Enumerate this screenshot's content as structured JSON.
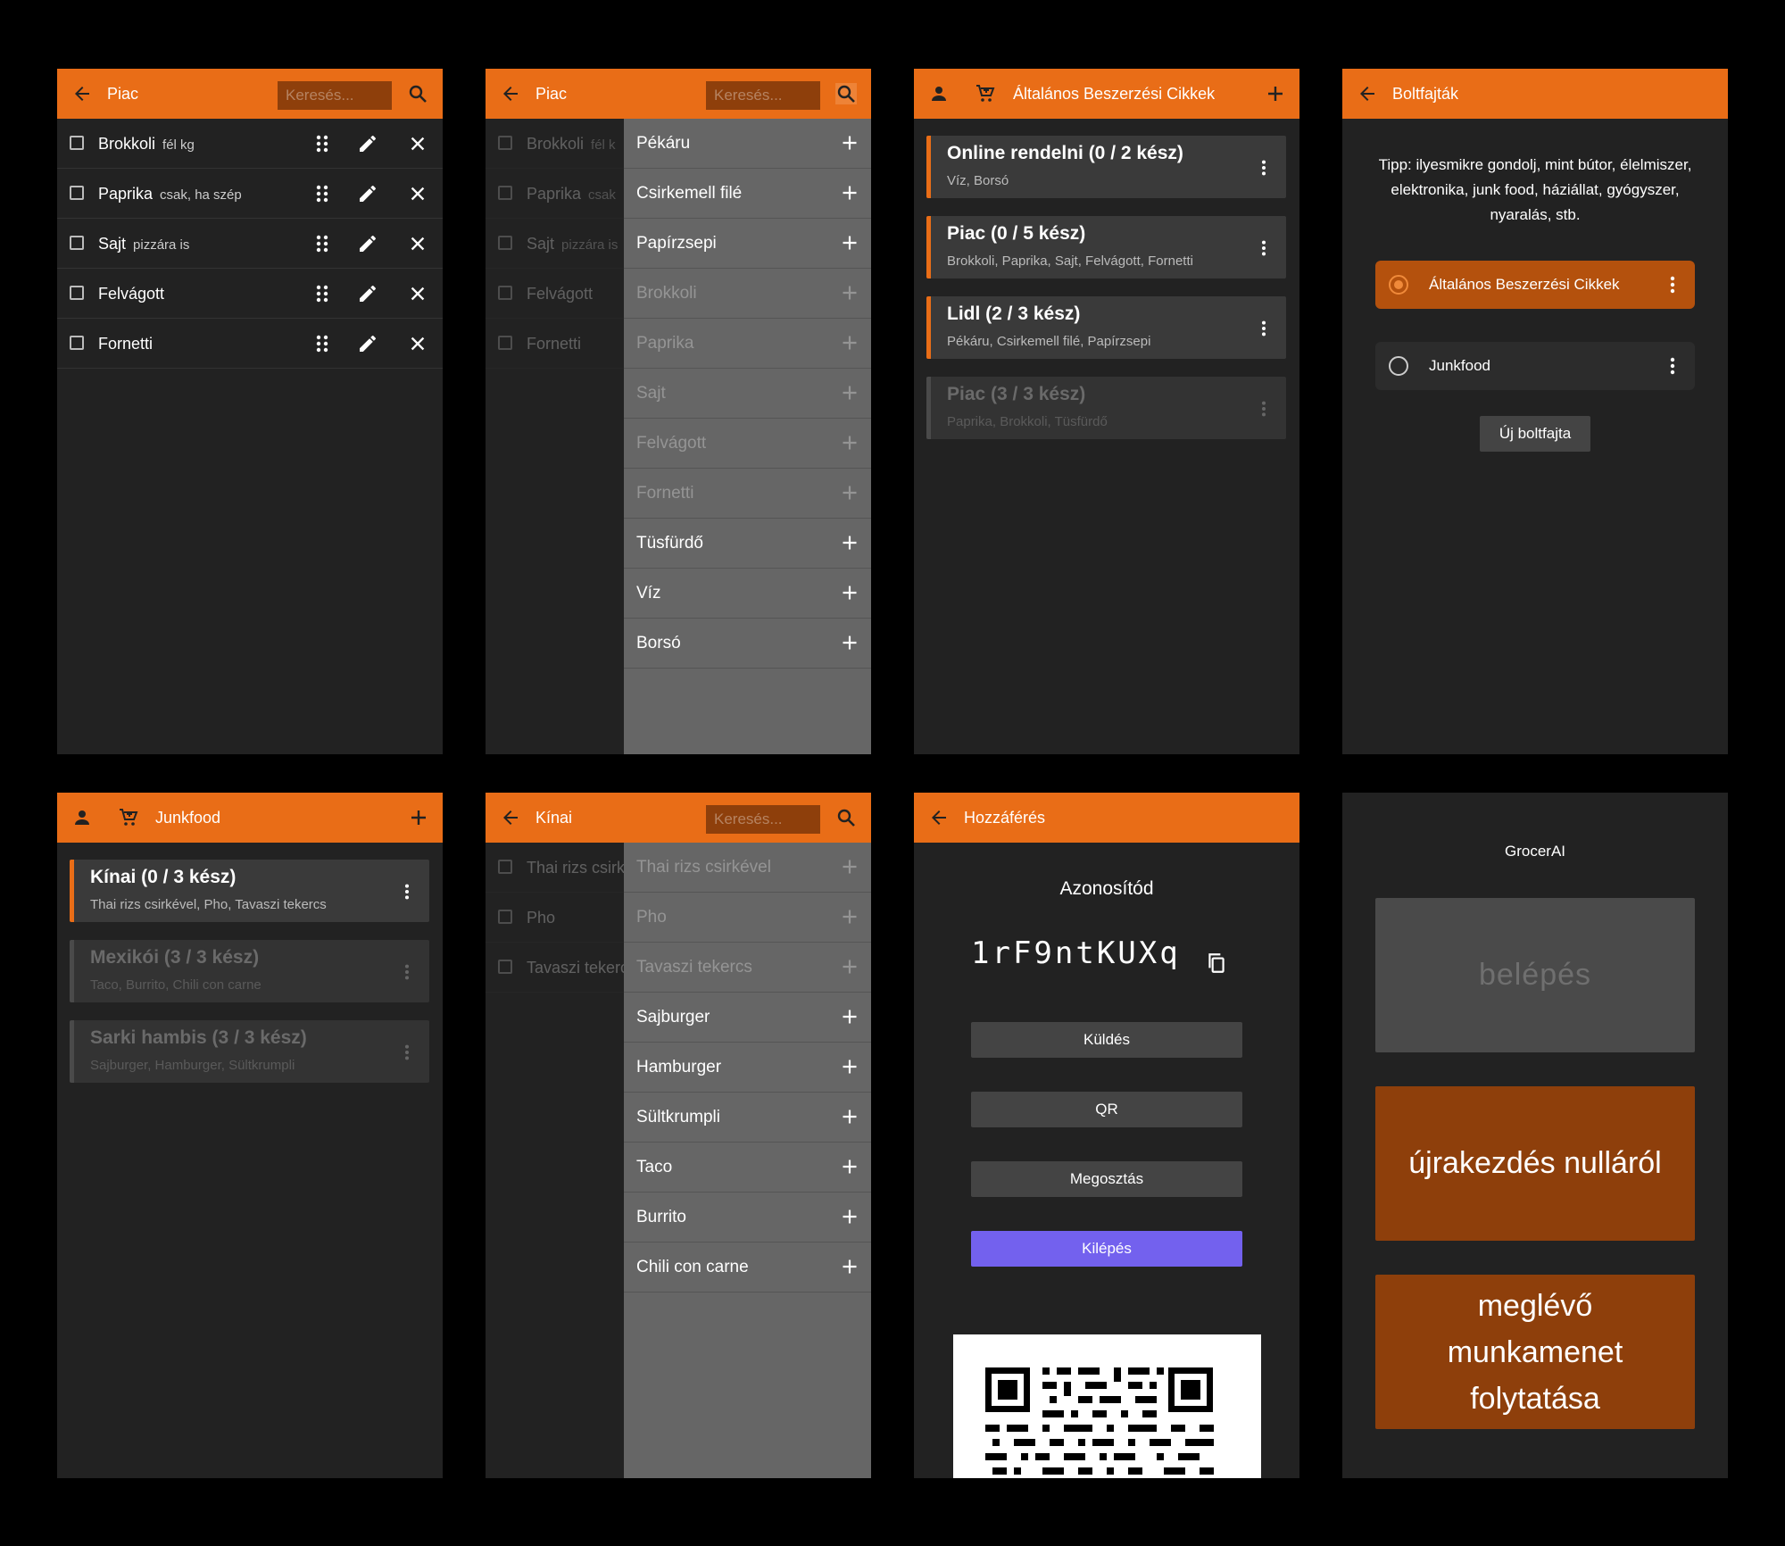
{
  "search_placeholder": "Keresés...",
  "screen1": {
    "title": "Piac",
    "items": [
      {
        "name": "Brokkoli",
        "note": "fél kg"
      },
      {
        "name": "Paprika",
        "note": "csak, ha szép"
      },
      {
        "name": "Sajt",
        "note": "pizzára is"
      },
      {
        "name": "Felvágott",
        "note": ""
      },
      {
        "name": "Fornetti",
        "note": ""
      }
    ]
  },
  "screen2": {
    "title": "Piac",
    "bg_items": [
      {
        "name": "Brokkoli",
        "note": "fél k"
      },
      {
        "name": "Paprika",
        "note": "csak"
      },
      {
        "name": "Sajt",
        "note": "pizzára is"
      },
      {
        "name": "Felvágott",
        "note": ""
      },
      {
        "name": "Fornetti",
        "note": ""
      }
    ],
    "drawer": [
      "Pékáru",
      "Csirkemell filé",
      "Papírzsepi",
      "Brokkoli",
      "Paprika",
      "Sajt",
      "Felvágott",
      "Fornetti",
      "Tüsfürdő",
      "Víz",
      "Borsó"
    ]
  },
  "screen3": {
    "title": "Általános Beszerzési Cikkek",
    "cards": [
      {
        "title": "Online rendelni (0 / 2 kész)",
        "subtitle": "Víz, Borsó"
      },
      {
        "title": "Piac (0 / 5 kész)",
        "subtitle": "Brokkoli, Paprika, Sajt, Felvágott, Fornetti"
      },
      {
        "title": "Lidl (2 / 3 kész)",
        "subtitle": "Pékáru, Csirkemell filé, Papírzsepi"
      },
      {
        "title": "Piac (3 / 3 kész)",
        "subtitle": "Paprika, Brokkoli, Tüsfürdő"
      }
    ]
  },
  "screen4": {
    "title": "Boltfajták",
    "tip": "Tipp: ilyesmikre gondolj, mint bútor, élelmiszer, elektronika, junk food, háziállat, gyógyszer, nyaralás, stb.",
    "types": [
      "Általános Beszerzési Cikkek",
      "Junkfood"
    ],
    "new_button": "Új boltfajta"
  },
  "screen5": {
    "title": "Junkfood",
    "cards": [
      {
        "title": "Kínai (0 / 3 kész)",
        "subtitle": "Thai rizs csirkével, Pho, Tavaszi tekercs"
      },
      {
        "title": "Mexikói (3 / 3 kész)",
        "subtitle": "Taco, Burrito, Chili con carne"
      },
      {
        "title": "Sarki hambis (3 / 3 kész)",
        "subtitle": "Sajburger, Hamburger, Sültkrumpli"
      }
    ]
  },
  "screen6": {
    "title": "Kínai",
    "bg_items": [
      {
        "name": "Thai rizs csirk",
        "note": ""
      },
      {
        "name": "Pho",
        "note": ""
      },
      {
        "name": "Tavaszi tekerc",
        "note": ""
      }
    ],
    "drawer": [
      "Thai rizs csirkével",
      "Pho",
      "Tavaszi tekercs",
      "Sajburger",
      "Hamburger",
      "Sültkrumpli",
      "Taco",
      "Burrito",
      "Chili con carne"
    ]
  },
  "screen7": {
    "title": "Hozzáférés",
    "id_label": "Azonosítód",
    "id_value": "1rF9ntKUXq",
    "buttons": [
      "Küldés",
      "QR",
      "Megosztás",
      "Kilépés"
    ]
  },
  "screen8": {
    "app_name": "GrocerAI",
    "login": "belépés",
    "restart": "újrakezdés nulláról",
    "continue": "meglévő munkamenet folytatása"
  },
  "colors": {
    "accent": "#e96d17",
    "purple": "#7361ee",
    "dark_orange": "#8e3f0b"
  }
}
